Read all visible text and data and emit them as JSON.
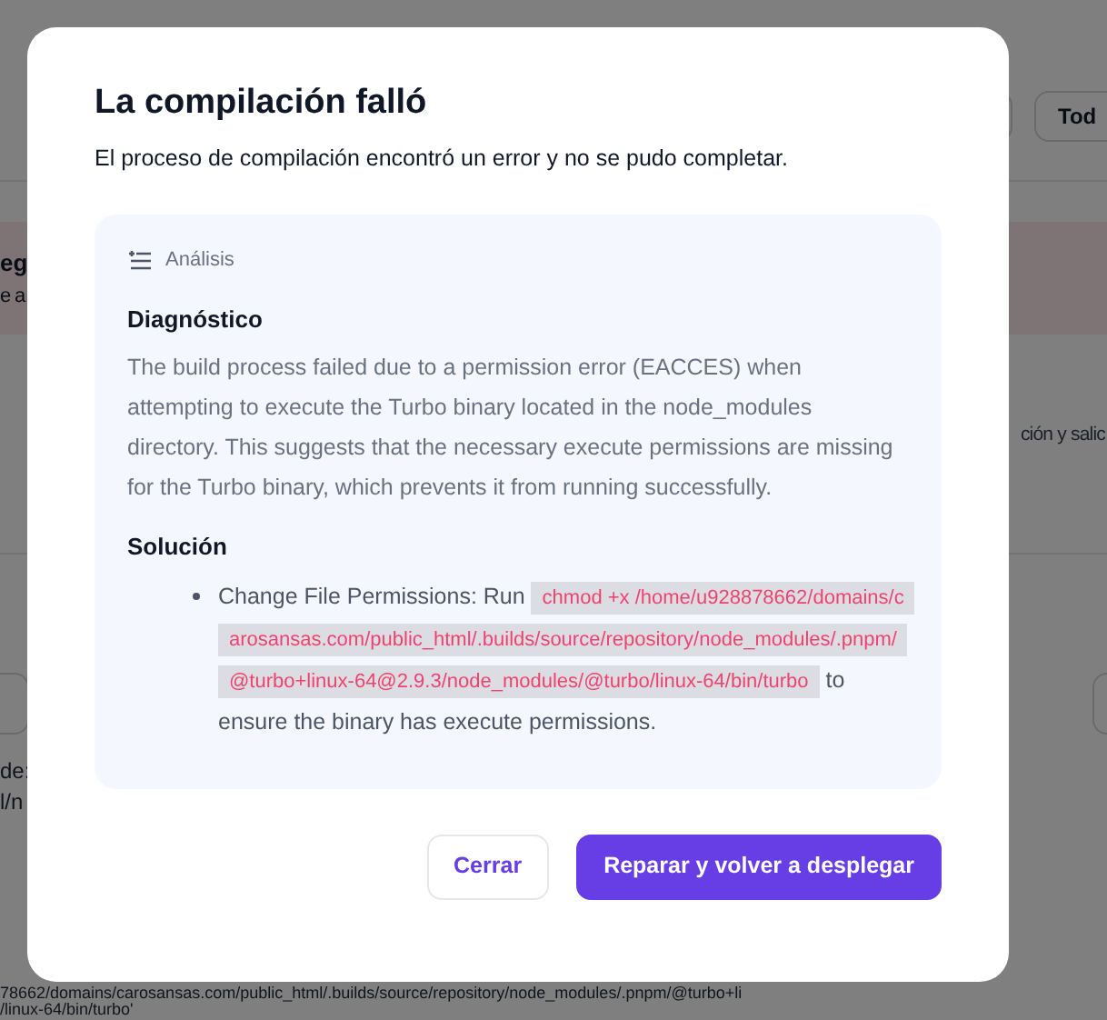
{
  "background": {
    "header_button": "Tod",
    "banner_lines": [
      "eg",
      "e a"
    ],
    "side_text": "ción y salic",
    "log_lines_left": [
      "de:",
      "l/n"
    ],
    "log_lines_bottom": [
      "78662/domains/carosansas.com/public_html/.builds/source/repository/node_modules/.pnpm/@turbo+li",
      "/linux-64/bin/turbo'"
    ]
  },
  "dialog": {
    "title": "La compilación falló",
    "subtitle": "El proceso de compilación encontró un error y no se pudo completar.",
    "analysis": {
      "label": "Análisis",
      "diagnosis_heading": "Diagnóstico",
      "diagnosis": "The build process failed due to a permission error (EACCES) when attempting to execute the Turbo binary located in the node_modules directory. This suggests that the necessary execute permissions are missing for the Turbo binary, which prevents it from running successfully.",
      "solution_heading": "Solución",
      "solution_items": [
        {
          "parts": [
            {
              "kind": "text",
              "text": "Change File Permissions: Run "
            },
            {
              "kind": "code",
              "text": "chmod +x /home/u928878662/domains/carosansas.com/public_html/.builds/source/repository/node_modules/.pnpm/@turbo+linux-64@2.9.3/node_modules/@turbo/linux-64/bin/turbo"
            },
            {
              "kind": "text",
              "text": " to ensure the binary has execute permissions."
            }
          ]
        }
      ]
    },
    "buttons": [
      {
        "label": "Cerrar",
        "kind": "secondary"
      },
      {
        "label": "Reparar y volver a desplegar",
        "kind": "primary"
      }
    ]
  }
}
